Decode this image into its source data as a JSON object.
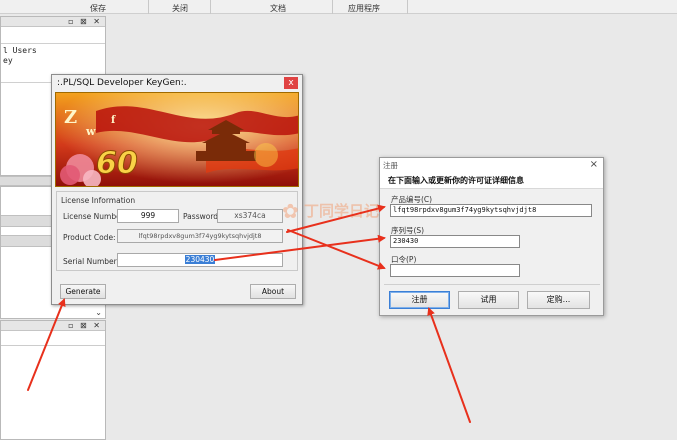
{
  "menubar": {
    "items": [
      "保存",
      "关闭",
      "文档",
      "应用程序"
    ]
  },
  "left_panel": {
    "tree_lines": [
      "l Users",
      "ey"
    ]
  },
  "keygen": {
    "title": ":.PL/SQL Developer KeyGen:.",
    "close_glyph": "x",
    "banner_text": "60",
    "group_label": "License Information",
    "license_number_label": "License Number:",
    "license_number": "999",
    "password_label": "Password:",
    "password": "xs374ca",
    "product_code_label": "Product Code:",
    "product_code": "lfqt98rpdxv8gum3f74yg9kytsqhvjdjt8",
    "serial_number_label": "Serial Number:",
    "serial_number": "230430",
    "generate_label": "Generate",
    "about_label": "About"
  },
  "register": {
    "title": "注册",
    "close_glyph": "×",
    "heading": "在下面输入或更新你的许可证详细信息",
    "product_code_label": "产品编号(C)",
    "product_code": "lfqt98rpdxv8gum3f74yg9kytsqhvjdjt8",
    "serial_label": "序列号(S)",
    "serial": "230430",
    "password_label": "口令(P)",
    "password": "",
    "register_label": "注册",
    "trial_label": "试用",
    "buy_label": "定购..."
  },
  "watermark": {
    "text": "丁同学日记"
  },
  "colors": {
    "arrow": "#e8301c",
    "selection": "#3b7fd6",
    "banner_red": "#c1190e",
    "banner_gold": "#f6b21c"
  }
}
